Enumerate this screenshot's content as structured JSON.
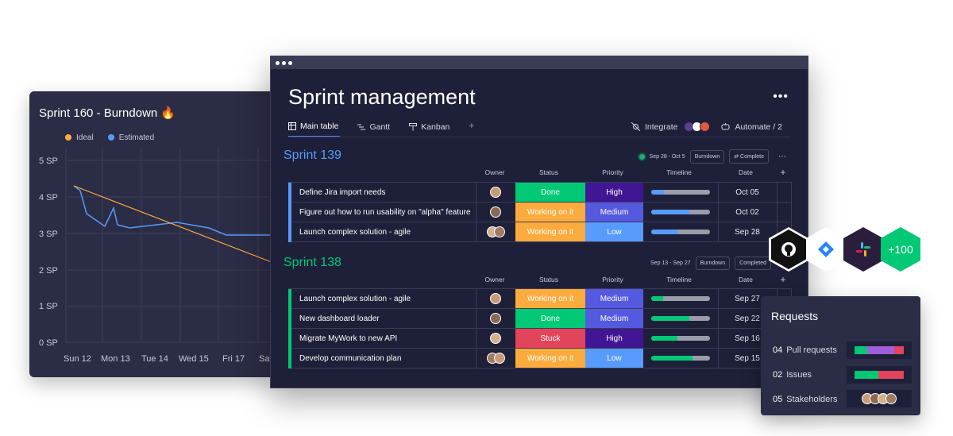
{
  "colors": {
    "done": "#00c875",
    "working": "#fdab3d",
    "stuck": "#e2445c",
    "high": "#401694",
    "medium": "#5559df",
    "low": "#579bfc",
    "sprint139": "#579bfc",
    "sprint138": "#00c875",
    "ideal": "#fdab3d",
    "estimated": "#579bfc"
  },
  "burndown": {
    "title": "Sprint 160 - Burndown 🔥",
    "legend": [
      "Ideal",
      "Estimated"
    ],
    "y_ticks": [
      "5 SP",
      "4 SP",
      "3 SP",
      "2 SP",
      "1 SP",
      "0 SP"
    ],
    "x_ticks": [
      "Sun 12",
      "Mon 13",
      "Tue 14",
      "Wed 15",
      "Fri 17",
      "Sat"
    ]
  },
  "app": {
    "title": "Sprint management",
    "more": "•••",
    "tabs": [
      "Main table",
      "Gantt",
      "Kanban"
    ],
    "add_tab": "+",
    "integrate": "Integrate",
    "automate": "Automate / 2"
  },
  "columns": {
    "owner": "Owner",
    "status": "Status",
    "priority": "Priority",
    "timeline": "Timeline",
    "date": "Date",
    "add": "+"
  },
  "groups": [
    {
      "title": "Sprint 139",
      "date_range": "Sep 28 - Oct 5",
      "burndown_btn": "Burndown",
      "complete_btn": "Complete",
      "rows": [
        {
          "name": "Define Jira import needs",
          "status": "Done",
          "status_key": "done",
          "priority": "High",
          "priority_key": "high",
          "progress": 0.22,
          "date": "Oct 05",
          "avatars": 1
        },
        {
          "name": "Figure out how to run usability on \"alpha\" feature",
          "status": "Working on it",
          "status_key": "working",
          "priority": "Medium",
          "priority_key": "medium",
          "progress": 0.65,
          "date": "Oct 02",
          "avatars": 1
        },
        {
          "name": "Launch complex solution - agile",
          "status": "Working on it",
          "status_key": "working",
          "priority": "Low",
          "priority_key": "low",
          "progress": 0.45,
          "date": "Sep 28",
          "avatars": 2
        }
      ]
    },
    {
      "title": "Sprint 138",
      "date_range": "Sep 13 - Sep 27",
      "burndown_btn": "Burndown",
      "complete_btn": "Completed",
      "rows": [
        {
          "name": "Launch complex solution - agile",
          "status": "Working on it",
          "status_key": "working",
          "priority": "Medium",
          "priority_key": "medium",
          "progress": 0.2,
          "date": "Sep 27",
          "avatars": 1
        },
        {
          "name": "New dashboard loader",
          "status": "Done",
          "status_key": "done",
          "priority": "Medium",
          "priority_key": "medium",
          "progress": 0.65,
          "date": "Sep 22",
          "avatars": 1
        },
        {
          "name": "Migrate MyWork to new API",
          "status": "Stuck",
          "status_key": "stuck",
          "priority": "High",
          "priority_key": "high",
          "progress": 0.45,
          "date": "Sep 16",
          "avatars": 1
        },
        {
          "name": "Develop communication plan",
          "status": "Working on it",
          "status_key": "working",
          "priority": "Low",
          "priority_key": "low",
          "progress": 0.7,
          "date": "Sep 15",
          "avatars": 2
        }
      ]
    }
  ],
  "integrations": {
    "items": [
      "github-icon",
      "jira-icon",
      "slack-icon"
    ],
    "more": "+100"
  },
  "requests": {
    "title": "Requests",
    "items": [
      {
        "count": "04",
        "label": "Pull requests"
      },
      {
        "count": "02",
        "label": "Issues"
      },
      {
        "count": "05",
        "label": "Stakeholders"
      }
    ]
  }
}
